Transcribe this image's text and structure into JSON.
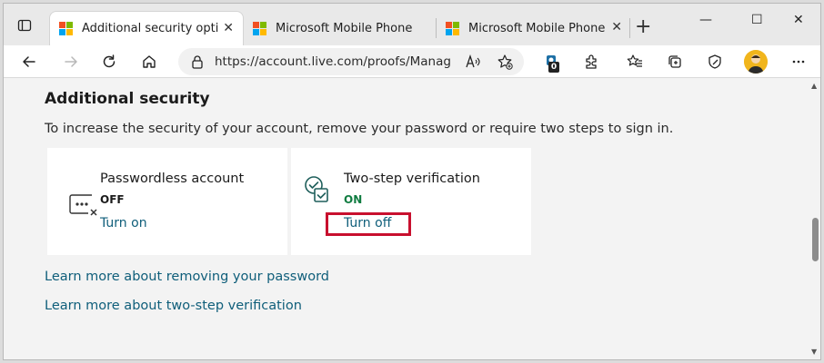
{
  "tabs": [
    {
      "title": "Additional security options",
      "active": true
    },
    {
      "title": "Microsoft Mobile Phone Au",
      "active": false
    },
    {
      "title": "Microsoft Mobile Phone Au",
      "active": false
    }
  ],
  "tab_close_glyph": "✕",
  "new_tab_glyph": "+",
  "window_controls": {
    "minimize": "—",
    "maximize": "☐",
    "close": "✕"
  },
  "address_bar": {
    "url": "https://account.live.com/proofs/Manag..."
  },
  "extension_badge": "0",
  "toolbar_icons": [
    "back-icon",
    "forward-icon",
    "refresh-icon",
    "home-icon",
    "lock-icon",
    "read-aloud-icon",
    "add-favorite-icon",
    "extension-icon",
    "extensions-icon",
    "favorites-icon",
    "collections-icon",
    "browser-essentials-icon",
    "profile-avatar",
    "more-icon"
  ],
  "page": {
    "title": "Additional security",
    "description": "To increase the security of your account, remove your password or require two steps to sign in.",
    "cards": [
      {
        "title": "Passwordless account",
        "state": "OFF",
        "link": "Turn on",
        "icon": "passwordless-icon"
      },
      {
        "title": "Two-step verification",
        "state": "ON",
        "link": "Turn off",
        "icon": "two-step-verification-icon"
      }
    ],
    "links": [
      "Learn more about removing your password",
      "Learn more about two-step verification"
    ]
  },
  "colors": {
    "link": "#0f5e7a",
    "on_state": "#107c41",
    "highlight": "#c8102e",
    "ms_red": "#f25022",
    "ms_green": "#7fba00",
    "ms_blue": "#00a4ef",
    "ms_yellow": "#ffb900"
  }
}
